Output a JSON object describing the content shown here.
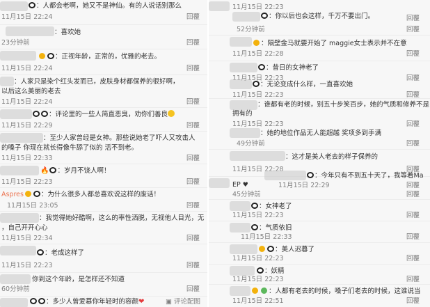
{
  "left_comments": [
    {
      "text": "：人都会老啊，她又不是神仙。有的人说话别那么",
      "time": "11月15日 22:24",
      "reply": "回覆"
    },
    {
      "text": "：喜欢她",
      "time": "23分钟前",
      "reply": "回覆"
    },
    {
      "text": "：正视年龄，正常的，优雅的老去。",
      "time": "11月15日 22:24",
      "reply": "回覆"
    },
    {
      "text": "：人家只是染个红头发而已，皮肤身材都保养的很好啊，",
      "text2": "以后这么美丽的老去",
      "time": "11月15日 22:24",
      "reply": "回覆"
    },
    {
      "text": "：评论里的一些人简直恶臭，劝你们善良",
      "time": "11月15日 22:29",
      "reply": "回覆"
    },
    {
      "text": "：至少人家曾经是女神。那些说她老了吓人又攻击人",
      "text2": "的嗓子  你现在就长得像牛舔了似的 活不到老。",
      "time": "11月15日 22:33",
      "reply": "回覆"
    },
    {
      "text": "：岁月不饶人啊！",
      "time": "11月15日 22:23",
      "reply": "回覆"
    },
    {
      "nick": "Aspres",
      "text": "：为什么很多人都总喜欢说这样的废话！",
      "time": "11月15日 23:05",
      "reply": "回覆"
    },
    {
      "text": "：我觉得她好酷啊，这么的率性洒脱，无视他人目光，无",
      "text2": "，自己开开心心",
      "time": "11月15日 22:34",
      "reply": "回覆"
    },
    {
      "text": "：老成这样了",
      "time": "11月15日 22:23",
      "reply": "回覆"
    },
    {
      "text": "你到这个年龄，是怎样还不知道",
      "time": "60分钟前",
      "reply": "回覆"
    },
    {
      "text": "：多少人曾爱慕你年轻时的容颜",
      "reply": "评论配图"
    }
  ],
  "right_comments": [
    {
      "text": "",
      "time": "11月15日 22:23",
      "reply": "回覆"
    },
    {
      "text": "：你以后也会这样，千万不要出门。",
      "time": "52分钟前",
      "reply": "回覆"
    },
    {
      "text": "：隔壁金马就要开始了 maggie女士表示并不在意",
      "time": "11月15日 22:28",
      "reply": "回覆"
    },
    {
      "text": "：昔日的女神老了",
      "time": "11月15日 22:23",
      "reply": "回覆"
    },
    {
      "text": "：无论变成什么样，一直喜欢她",
      "time": "11月15日 22:23",
      "reply": "回覆"
    },
    {
      "text": "：谁都有老的时候，别五十步笑百步，她的气质和修养不是",
      "text2": "拥有的",
      "time": "11月15日 22:23",
      "reply": "回覆"
    },
    {
      "text": "：她的地位作品无人能超越 奖项多到手满",
      "time": "49分钟前",
      "reply": "回覆"
    },
    {
      "text": "：这才是美人老去的样子保养的",
      "time": "11月15日 22:28",
      "reply": "回覆"
    },
    {
      "nick": "EP",
      "text": "",
      "time": "45分钟前",
      "reply": "回覆"
    },
    {
      "text": "：今年只有不到五十天了，我等着Ma",
      "time": "11月15日 22:29",
      "reply": "回覆"
    },
    {
      "text": "：女神老了",
      "time": "11月15日 22:23",
      "reply": "回覆"
    },
    {
      "text": "：气质依旧",
      "time": "11月15日 22:33",
      "reply": "回覆"
    },
    {
      "text": "：美人迟暮了",
      "time": "11月15日 22:23",
      "reply": "回覆"
    },
    {
      "text": "：妖精",
      "time": "11月15日 22:23",
      "reply": "回覆"
    },
    {
      "text": "：人都有老去的时候，嗓子们老去的时候，这谁说当",
      "time": "11月15日 22:51",
      "reply": "回覆"
    }
  ],
  "colors": {
    "nick": "#eb7350",
    "meta": "#808080",
    "text": "#333333"
  }
}
